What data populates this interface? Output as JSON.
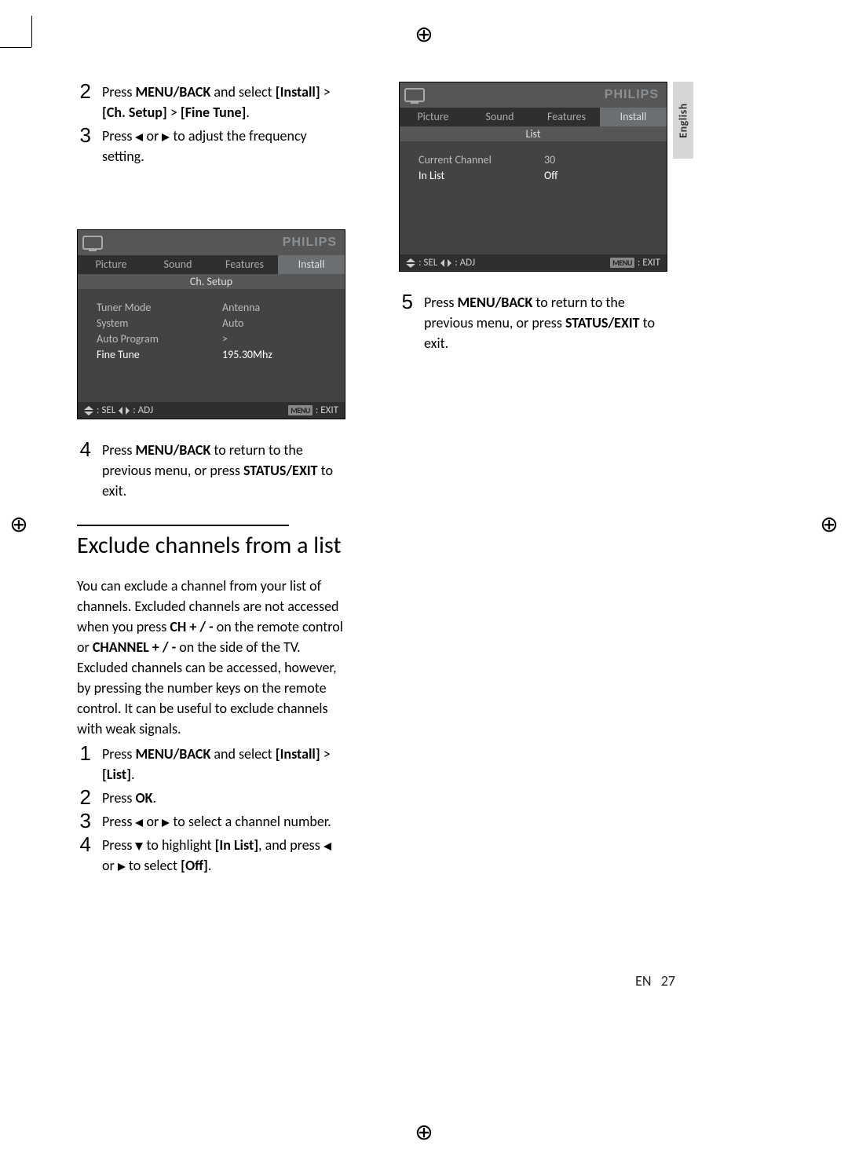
{
  "reg_glyph": "⊕",
  "lang_tab": "English",
  "page_footer": {
    "lang": "EN",
    "num": "27"
  },
  "left_steps_a": [
    {
      "n": "2",
      "parts": [
        "Press ",
        "MENU/BACK",
        " and select ",
        "[Install]",
        " > ",
        "[Ch. Setup]",
        " > ",
        "[Fine Tune]",
        "."
      ]
    },
    {
      "n": "3",
      "text_pre": "Press ",
      "text_mid": " or ",
      "text_post": " to adjust the frequency setting."
    }
  ],
  "osd1": {
    "brand": "PHILIPS",
    "tabs": [
      "Picture",
      "Sound",
      "Features",
      "Install"
    ],
    "subtitle": "Ch. Setup",
    "rows": [
      {
        "label": "Tuner Mode",
        "value": "Antenna"
      },
      {
        "label": "System",
        "value": "Auto"
      },
      {
        "label": "Auto Program",
        "value": ">"
      },
      {
        "label": "Fine Tune",
        "value": "195.30Mhz"
      }
    ],
    "footer": {
      "sel": ": SEL",
      "adj": ": ADJ",
      "menu": "MENU",
      "exit": ": EXIT"
    }
  },
  "left_steps_b": [
    {
      "n": "4",
      "parts": [
        "Press ",
        "MENU/BACK",
        " to return to the previous menu, or press ",
        "STATUS/EXIT",
        " to exit."
      ]
    }
  ],
  "section2_heading": "Exclude channels from a list",
  "section2_para_segments": [
    "You can exclude a channel from your list of channels. Excluded channels are not accessed when you press ",
    "CH + / -",
    " on the remote control or ",
    "CHANNEL + / -",
    " on the side of the TV. Excluded channels can be accessed, however, by pressing the number keys on the remote control. It can be useful to exclude channels with weak signals."
  ],
  "section2_steps": [
    {
      "n": "1",
      "parts": [
        "Press ",
        "MENU/BACK",
        " and select ",
        "[Install]",
        " > ",
        "[List]",
        "."
      ]
    },
    {
      "n": "2",
      "parts": [
        "Press ",
        "OK",
        "."
      ]
    },
    {
      "n": "3",
      "text_pre": "Press ",
      "text_mid": " or ",
      "text_post": " to select a channel number."
    },
    {
      "n": "4",
      "text_pre": "Press ",
      "mid1": " to highlight ",
      "b1": "[In List]",
      "mid2": ", and press ",
      "mid3": " or ",
      "mid4": " to select ",
      "b2": "[Off]",
      "end": "."
    }
  ],
  "osd2": {
    "brand": "PHILIPS",
    "tabs": [
      "Picture",
      "Sound",
      "Features",
      "Install"
    ],
    "subtitle": "List",
    "rows": [
      {
        "label": "Current Channel",
        "value": "30"
      },
      {
        "label": "In List",
        "value": "Off"
      }
    ],
    "footer": {
      "sel": ": SEL",
      "adj": ": ADJ",
      "menu": "MENU",
      "exit": ": EXIT"
    }
  },
  "right_steps": [
    {
      "n": "5",
      "parts": [
        "Press ",
        "MENU/BACK",
        " to return to the previous menu, or press ",
        "STATUS/EXIT",
        " to exit."
      ]
    }
  ]
}
